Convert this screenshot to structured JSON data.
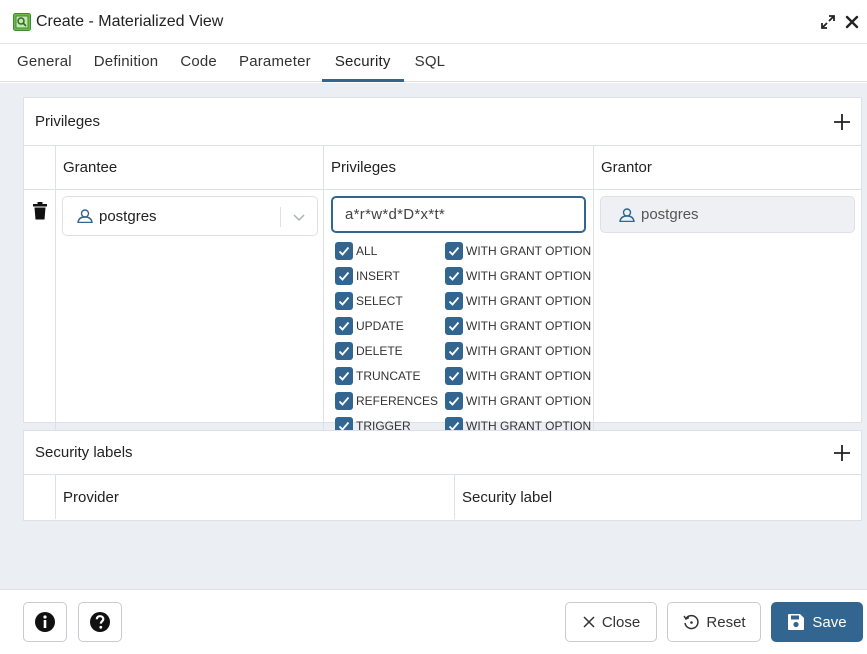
{
  "window": {
    "title": "Create - Materialized View"
  },
  "tabs": [
    {
      "label": "General"
    },
    {
      "label": "Definition"
    },
    {
      "label": "Code"
    },
    {
      "label": "Parameter"
    },
    {
      "label": "Security",
      "active": true
    },
    {
      "label": "SQL"
    }
  ],
  "privileges": {
    "title": "Privileges",
    "columns": [
      "Grantee",
      "Privileges",
      "Grantor"
    ],
    "row": {
      "grantee": "postgres",
      "privileges_value": "a*r*w*d*D*x*t*",
      "grantor": "postgres",
      "options": [
        {
          "name": "ALL",
          "checked": true,
          "grant_option": "WITH GRANT OPTION",
          "grant_checked": true
        },
        {
          "name": "INSERT",
          "checked": true,
          "grant_option": "WITH GRANT OPTION",
          "grant_checked": true
        },
        {
          "name": "SELECT",
          "checked": true,
          "grant_option": "WITH GRANT OPTION",
          "grant_checked": true
        },
        {
          "name": "UPDATE",
          "checked": true,
          "grant_option": "WITH GRANT OPTION",
          "grant_checked": true
        },
        {
          "name": "DELETE",
          "checked": true,
          "grant_option": "WITH GRANT OPTION",
          "grant_checked": true
        },
        {
          "name": "TRUNCATE",
          "checked": true,
          "grant_option": "WITH GRANT OPTION",
          "grant_checked": true
        },
        {
          "name": "REFERENCES",
          "checked": true,
          "grant_option": "WITH GRANT OPTION",
          "grant_checked": true
        },
        {
          "name": "TRIGGER",
          "checked": true,
          "grant_option": "WITH GRANT OPTION",
          "grant_checked": true
        }
      ]
    }
  },
  "security_labels": {
    "title": "Security labels",
    "columns": [
      "Provider",
      "Security label"
    ]
  },
  "footer": {
    "close_label": "Close",
    "reset_label": "Reset",
    "save_label": "Save"
  },
  "colors": {
    "accent": "#326690",
    "background": "#ebeef3"
  }
}
